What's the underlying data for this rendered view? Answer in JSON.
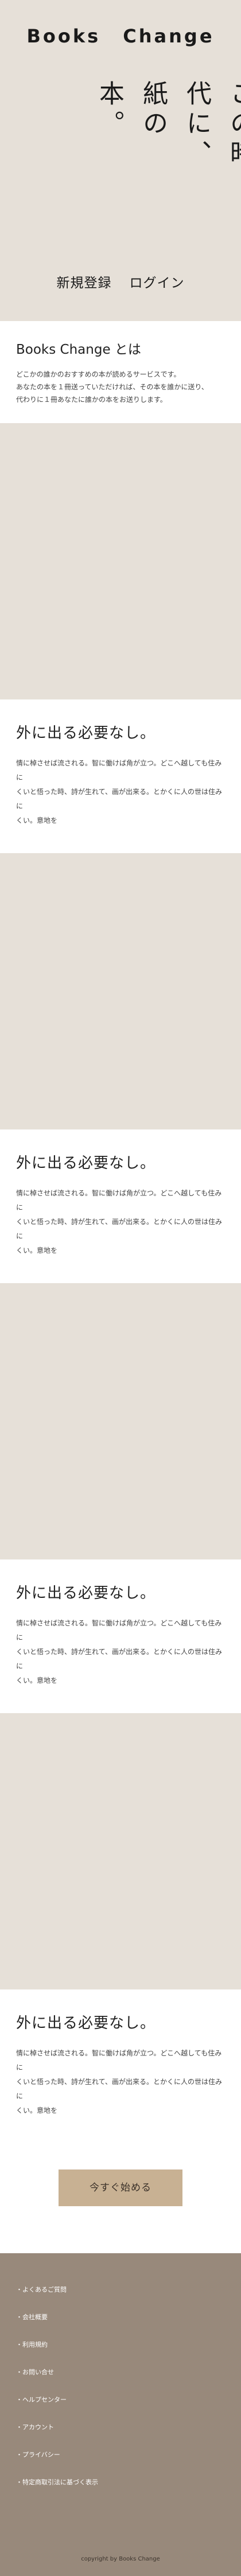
{
  "hero": {
    "brand": "Books Change",
    "tagline_line1": "この時代に、",
    "tagline_line2": "紙の本。",
    "signup_label": "新規登録",
    "login_label": "ログイン"
  },
  "about": {
    "title": "Books Change とは",
    "lines": [
      "どこかの誰かのおすすめの本が読めるサービスです。",
      "あなたの本を１冊送っていただければ、その本を誰かに送り、",
      "代わりに１冊あなたに誰かの本をお送りします。"
    ]
  },
  "features": [
    {
      "title": "外に出る必要なし。",
      "lines": [
        "情に棹させば流される。智に働けば角が立つ。どこへ越しても住みに",
        "くいと悟った時、詩が生れて、画が出来る。とかくに人の世は住みに",
        "くい。意地を"
      ]
    },
    {
      "title": "外に出る必要なし。",
      "lines": [
        "情に棹させば流される。智に働けば角が立つ。どこへ越しても住みに",
        "くいと悟った時、詩が生れて、画が出来る。とかくに人の世は住みに",
        "くい。意地を"
      ]
    },
    {
      "title": "外に出る必要なし。",
      "lines": [
        "情に棹させば流される。智に働けば角が立つ。どこへ越しても住みに",
        "くいと悟った時、詩が生れて、画が出来る。とかくに人の世は住みに",
        "くい。意地を"
      ]
    },
    {
      "title": "外に出る必要なし。",
      "lines": [
        "情に棹させば流される。智に働けば角が立つ。どこへ越しても住みに",
        "くいと悟った時、詩が生れて、画が出来る。とかくに人の世は住みに",
        "くい。意地を"
      ]
    }
  ],
  "cta": {
    "label": "今すぐ始める"
  },
  "footer": {
    "links": [
      "・よくあるご質問",
      "・会社概要",
      "・利用規約",
      "・お問い合せ",
      "・ヘルプセンター",
      "・アカウント",
      "・プライバシー",
      "・特定商取引法に基づく表示"
    ],
    "copyright": "copyright by Books Change"
  },
  "colors": {
    "hero_bg": "#e6e0d8",
    "cta_bg": "#c8b193",
    "footer_bg": "#98897b"
  }
}
